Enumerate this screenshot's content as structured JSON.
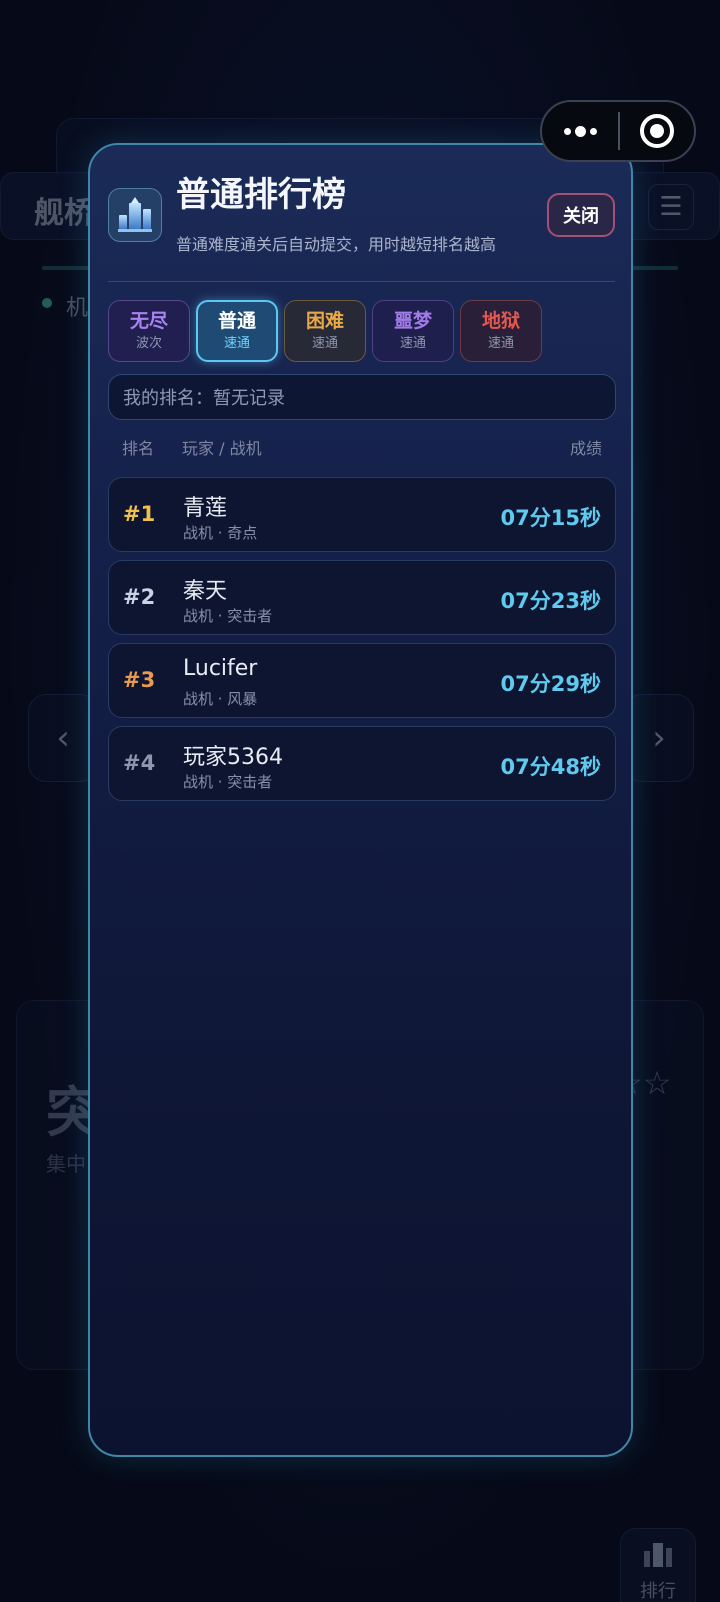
{
  "background": {
    "title": "舰桥",
    "subtitle": "机",
    "menu_icon": "☰",
    "left_arrow": "‹",
    "right_arrow": "›",
    "card_title": "突",
    "card_desc": "集中",
    "card_stars": "☆☆",
    "rank_button_label": "排行"
  },
  "modal": {
    "icon": "trophy-building-icon",
    "title": "普通排行榜",
    "subtitle": "普通难度通关后自动提交，用时越短排名越高",
    "close_label": "关闭",
    "tabs": [
      {
        "label": "无尽",
        "sub": "波次",
        "active": false
      },
      {
        "label": "普通",
        "sub": "速通",
        "active": true
      },
      {
        "label": "困难",
        "sub": "速通",
        "active": false
      },
      {
        "label": "噩梦",
        "sub": "速通",
        "active": false
      },
      {
        "label": "地狱",
        "sub": "速通",
        "active": false
      }
    ],
    "my_rank": "我的排名：暂无记录",
    "columns": {
      "rank": "排名",
      "player": "玩家 / 战机",
      "score": "成绩"
    },
    "rows": [
      {
        "rank": "#1",
        "name": "青莲",
        "ship": "战机 · 奇点",
        "score": "07分15秒",
        "rank_color": "#f0c14a"
      },
      {
        "rank": "#2",
        "name": "秦天",
        "ship": "战机 · 突击者",
        "score": "07分23秒",
        "rank_color": "#c9d3e6"
      },
      {
        "rank": "#3",
        "name": "Lucifer",
        "ship": "战机 · 风暴",
        "score": "07分29秒",
        "rank_color": "#e89a4f"
      },
      {
        "rank": "#4",
        "name": "玩家5364",
        "ship": "战机 · 突击者",
        "score": "07分48秒",
        "rank_color": "#8d97ad"
      }
    ]
  },
  "colors": {
    "accent": "#5cc7f2",
    "modal_border": "#3f86a7",
    "score": "#5fc9ee"
  }
}
